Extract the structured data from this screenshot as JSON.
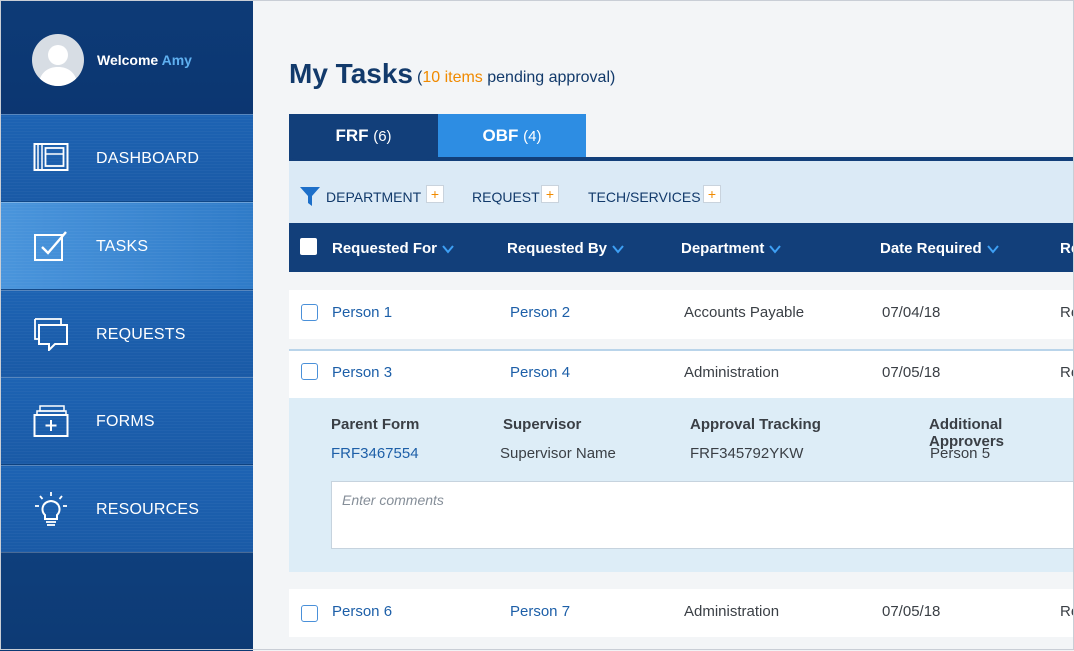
{
  "user": {
    "welcome_prefix": "Welcome",
    "name": "Amy"
  },
  "sidebar": {
    "items": [
      {
        "label": "DASHBOARD",
        "icon": "dashboard-icon"
      },
      {
        "label": "TASKS",
        "icon": "tasks-check-icon",
        "active": true
      },
      {
        "label": "REQUESTS",
        "icon": "speech-bubbles-icon"
      },
      {
        "label": "FORMS",
        "icon": "forms-folder-icon"
      },
      {
        "label": "RESOURCES",
        "icon": "lightbulb-icon"
      }
    ]
  },
  "page": {
    "title": "My Tasks",
    "subtitle_open": "(",
    "pending_count": "10 items",
    "subtitle_rest": " pending approval)"
  },
  "tabs": [
    {
      "label": "FRF",
      "count": "(6)",
      "active": true
    },
    {
      "label": "OBF",
      "count": "(4)",
      "active": false
    }
  ],
  "filters": [
    {
      "label": "DEPARTMENT",
      "add": "+"
    },
    {
      "label": "REQUEST",
      "add": "+"
    },
    {
      "label": "TECH/SERVICES",
      "add": "+"
    }
  ],
  "table": {
    "columns": [
      "Requested For",
      "Requested By",
      "Department",
      "Date Required",
      "Re"
    ],
    "rows": [
      {
        "requested_for": "Person 1",
        "requested_by": "Person 2",
        "department": "Accounts Payable",
        "date_required": "07/04/18",
        "extra": "Re"
      },
      {
        "requested_for": "Person 3",
        "requested_by": "Person 4",
        "department": "Administration",
        "date_required": "07/05/18",
        "extra": "Re"
      },
      {
        "requested_for": "Person 6",
        "requested_by": "Person 7",
        "department": "Administration",
        "date_required": "07/05/18",
        "extra": "Re"
      }
    ]
  },
  "detail": {
    "parent_form_label": "Parent Form",
    "parent_form_value": "FRF3467554",
    "supervisor_label": "Supervisor",
    "supervisor_value": "Supervisor Name",
    "approval_label": "Approval Tracking",
    "approval_value": "FRF345792YKW",
    "approvers_label": "Additional Approvers",
    "approvers_value": "Person 5",
    "comments_placeholder": "Enter comments"
  },
  "colors": {
    "sidebar_dark": "#0d3b77",
    "sidebar_item": "#1d63b3",
    "accent_orange": "#f08a00",
    "header_navy": "#123f7a",
    "tab_blue": "#2d8de3",
    "link_blue": "#1d5fa8"
  }
}
